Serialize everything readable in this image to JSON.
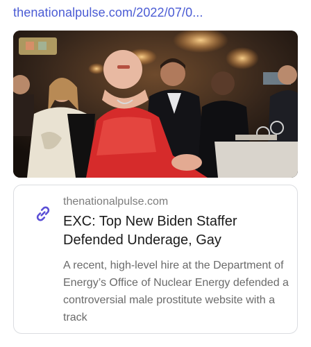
{
  "result": {
    "url": "thenationalpulse.com/2022/07/0...",
    "image_alt": "Photo of attendees at a formal banquet, a man in a red off-shoulder dress seated in the front",
    "card": {
      "domain": "thenationalpulse.com",
      "title": "EXC: Top New Biden Staffer Defended Underage, Gay",
      "description": "A recent, high-level hire at the Department of Energy’s Office of Nuclear Energy defended a controversial male prostitute website with a track"
    },
    "icons": {
      "link": "link-icon"
    },
    "colors": {
      "url": "#4a5bd4",
      "link_icon": "#5b4fd6",
      "dress": "#d62b2b"
    }
  }
}
